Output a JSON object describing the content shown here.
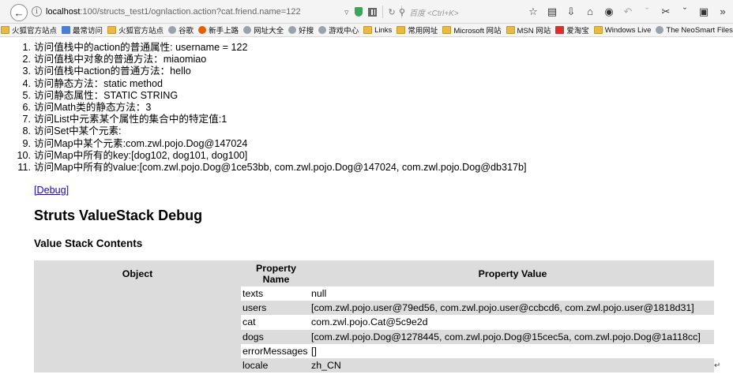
{
  "browser": {
    "url_prefix": "localhost",
    "url_rest": ":100/structs_test1/ognlaction.action?cat.friend.name=122",
    "search_placeholder": "百度 <Ctrl+K>"
  },
  "bookmarks": [
    {
      "label": "火狐官方站点",
      "icon": "folder"
    },
    {
      "label": "最常访问",
      "icon": "blue"
    },
    {
      "label": "火狐官方站点",
      "icon": "folder"
    },
    {
      "label": "谷歌",
      "icon": "globe"
    },
    {
      "label": "新手上路",
      "icon": "firefox"
    },
    {
      "label": "网址大全",
      "icon": "globe"
    },
    {
      "label": "好搜",
      "icon": "globe"
    },
    {
      "label": "游戏中心",
      "icon": "globe"
    },
    {
      "label": "Links",
      "icon": "folder"
    },
    {
      "label": "常用网址",
      "icon": "folder"
    },
    {
      "label": "Microsoft 网站",
      "icon": "folder"
    },
    {
      "label": "MSN 网站",
      "icon": "folder"
    },
    {
      "label": "爱淘宝",
      "icon": "red"
    },
    {
      "label": "Windows Live",
      "icon": "folder"
    },
    {
      "label": "The NeoSmart Files",
      "icon": "globe"
    }
  ],
  "items": [
    {
      "num": "1.",
      "text": "访问值栈中的action的普通属性: username = 122"
    },
    {
      "num": "2.",
      "text": "访问值栈中对象的普通方法：miaomiao"
    },
    {
      "num": "3.",
      "text": "访问值栈中action的普通方法：hello"
    },
    {
      "num": "4.",
      "text": "访问静态方法：static method"
    },
    {
      "num": "5.",
      "text": "访问静态属性：STATIC STRING"
    },
    {
      "num": "6.",
      "text": "访问Math类的静态方法：3"
    },
    {
      "num": "7.",
      "text": "访问List中元素某个属性的集合中的特定值:1"
    },
    {
      "num": "8.",
      "text": "访问Set中某个元素:"
    },
    {
      "num": "9.",
      "text": "访问Map中某个元素:com.zwl.pojo.Dog@147024"
    },
    {
      "num": "10.",
      "text": "访问Map中所有的key:[dog102, dog101, dog100]"
    },
    {
      "num": "11.",
      "text": "访问Map中所有的value:[com.zwl.pojo.Dog@1ce53bb, com.zwl.pojo.Dog@147024, com.zwl.pojo.Dog@db317b]"
    }
  ],
  "debug_link": "[Debug]",
  "heading": "Struts ValueStack Debug",
  "subheading": "Value Stack Contents",
  "table": {
    "headers": [
      "Object",
      "Property Name",
      "Property Value"
    ],
    "rows": [
      {
        "name": "texts",
        "value": "null"
      },
      {
        "name": "users",
        "value": "[com.zwl.pojo.user@79ed56, com.zwl.pojo.user@ccbcd6, com.zwl.pojo.user@1818d31]"
      },
      {
        "name": "cat",
        "value": "com.zwl.pojo.Cat@5c9e2d"
      },
      {
        "name": "dogs",
        "value": "[com.zwl.pojo.Dog@1278445, com.zwl.pojo.Dog@15cec5a, com.zwl.pojo.Dog@1a118cc]"
      },
      {
        "name": "errorMessages",
        "value": "[]"
      },
      {
        "name": "locale",
        "value": "zh_CN"
      }
    ]
  }
}
